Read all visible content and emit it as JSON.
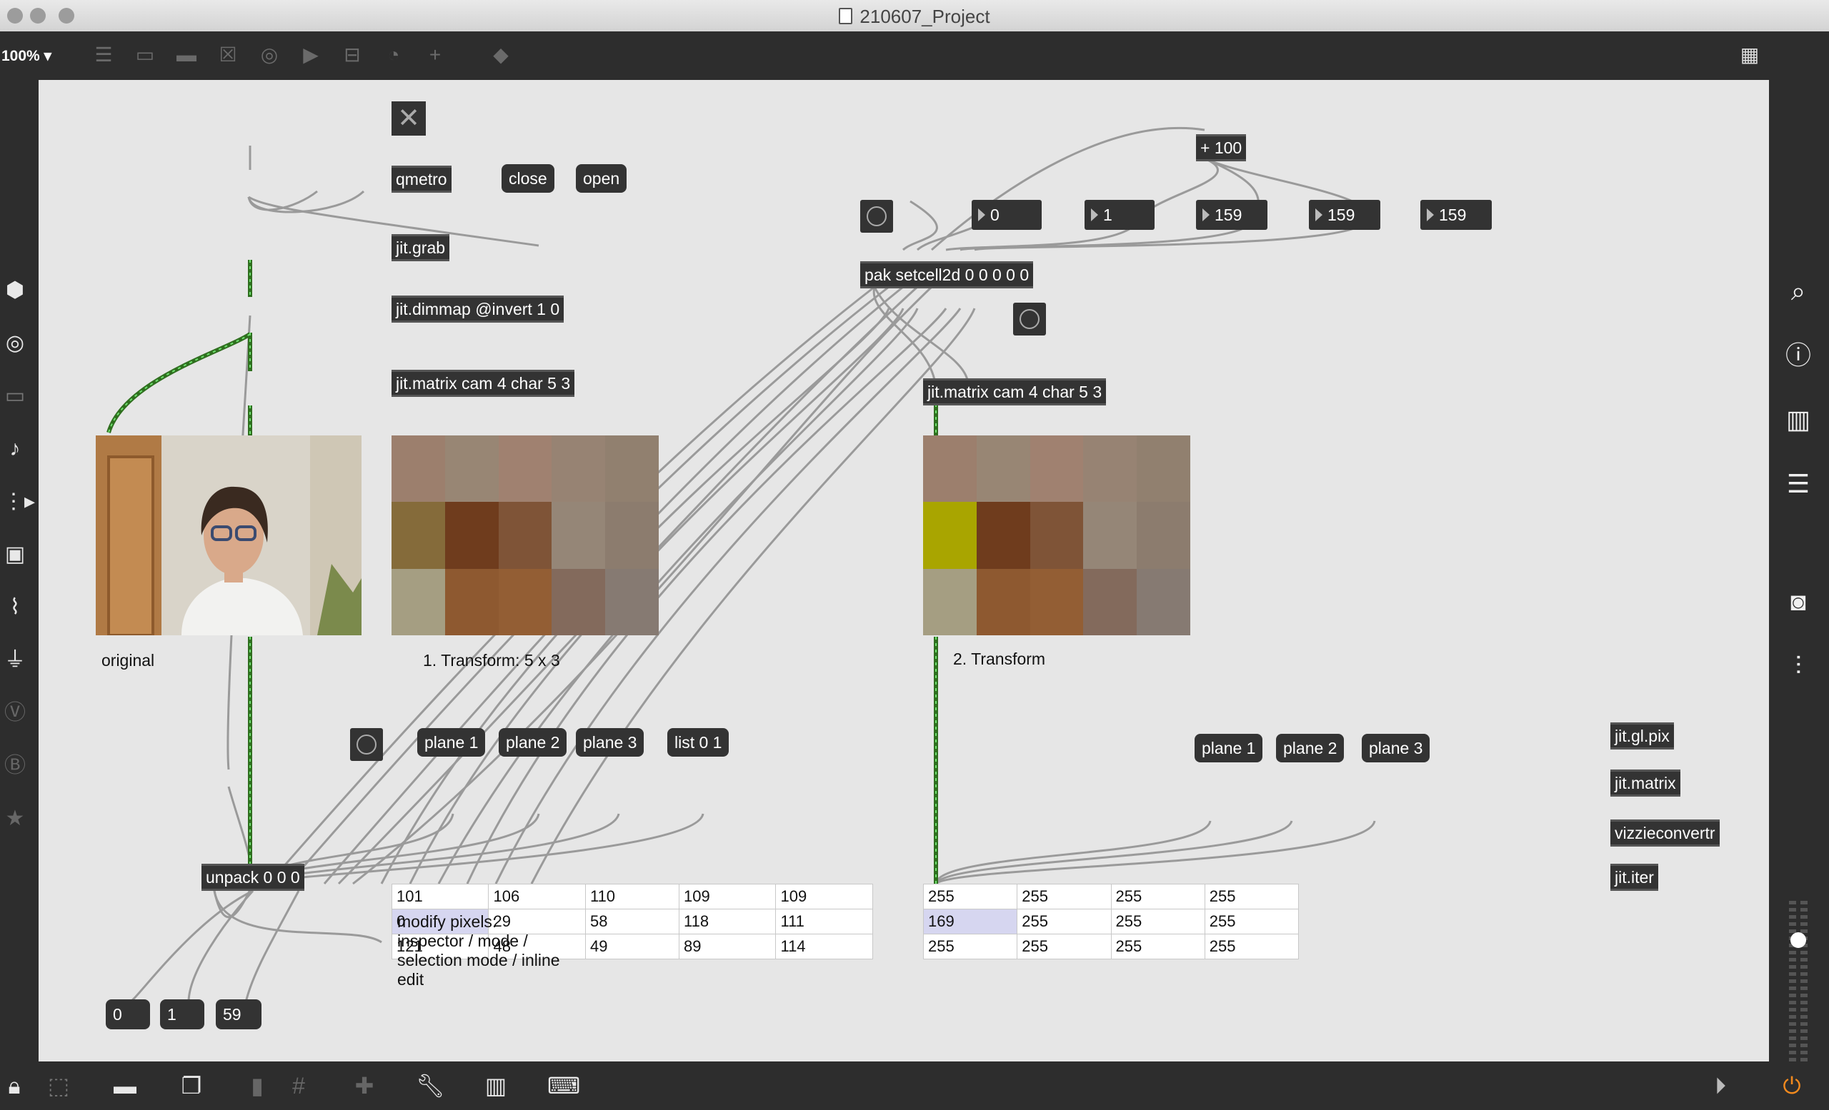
{
  "window": {
    "title": "210607_Project"
  },
  "toolbar": {
    "zoom": "100%"
  },
  "patch": {
    "toggle_icon": "x-toggle-icon",
    "objects": {
      "qmetro": "qmetro",
      "jit_grab": "jit.grab",
      "jit_dimmap": "jit.dimmap @invert 1 0",
      "jit_matrix_1": "jit.matrix cam 4 char 5 3",
      "pak": "pak setcell2d 0 0 0 0 0",
      "add": "+ 100",
      "jit_matrix_2": "jit.matrix cam 4 char 5 3",
      "unpack": "unpack 0 0 0",
      "jit_gl_pix": "jit.gl.pix",
      "jit_matrix_side": "jit.matrix",
      "vizzieconvertr": "vizzieconvertr",
      "jit_iter": "jit.iter"
    },
    "messages": {
      "close": "close",
      "open": "open",
      "plane1_a": "plane 1",
      "plane2_a": "plane 2",
      "plane3_a": "plane 3",
      "list": "list 0 1",
      "plane1_b": "plane 1",
      "plane2_b": "plane 2",
      "plane3_b": "plane 3"
    },
    "numbers": {
      "n0": "0",
      "n1": "1",
      "n159a": "159",
      "n159b": "159",
      "n159c": "159",
      "u0": "0",
      "u1": "1",
      "u59": "59"
    },
    "labels": {
      "original": "original",
      "transform1": "1. Transform: 5 x 3",
      "transform2": "2. Transform",
      "modify": "modify pixels:\ninspector / mode /\nselection mode /  inline\nedit"
    },
    "matrix1_colors": [
      [
        "#9c7f6d",
        "#988674",
        "#a08170",
        "#978373",
        "#91806f"
      ],
      [
        "#856b3a",
        "#6f3c1d",
        "#7f5437",
        "#958677",
        "#8c7c6e"
      ],
      [
        "#a59e82",
        "#8e5930",
        "#935e34",
        "#836a5c",
        "#867a72"
      ]
    ],
    "matrix2_colors": [
      [
        "#9c7f6d",
        "#988674",
        "#a08170",
        "#978373",
        "#91806f"
      ],
      [
        "#a9a500",
        "#6f3c1d",
        "#7f5437",
        "#958677",
        "#8c7c6e"
      ],
      [
        "#a59e82",
        "#8e5930",
        "#935e34",
        "#836a5c",
        "#867a72"
      ]
    ],
    "table1": [
      [
        "101",
        "106",
        "110",
        "109",
        "109"
      ],
      [
        "0",
        "29",
        "58",
        "118",
        "111"
      ],
      [
        "121",
        "48",
        "49",
        "89",
        "114"
      ]
    ],
    "table2": [
      [
        "255",
        "255",
        "255",
        "255"
      ],
      [
        "169",
        "255",
        "255",
        "255"
      ],
      [
        "255",
        "255",
        "255",
        "255"
      ]
    ]
  }
}
